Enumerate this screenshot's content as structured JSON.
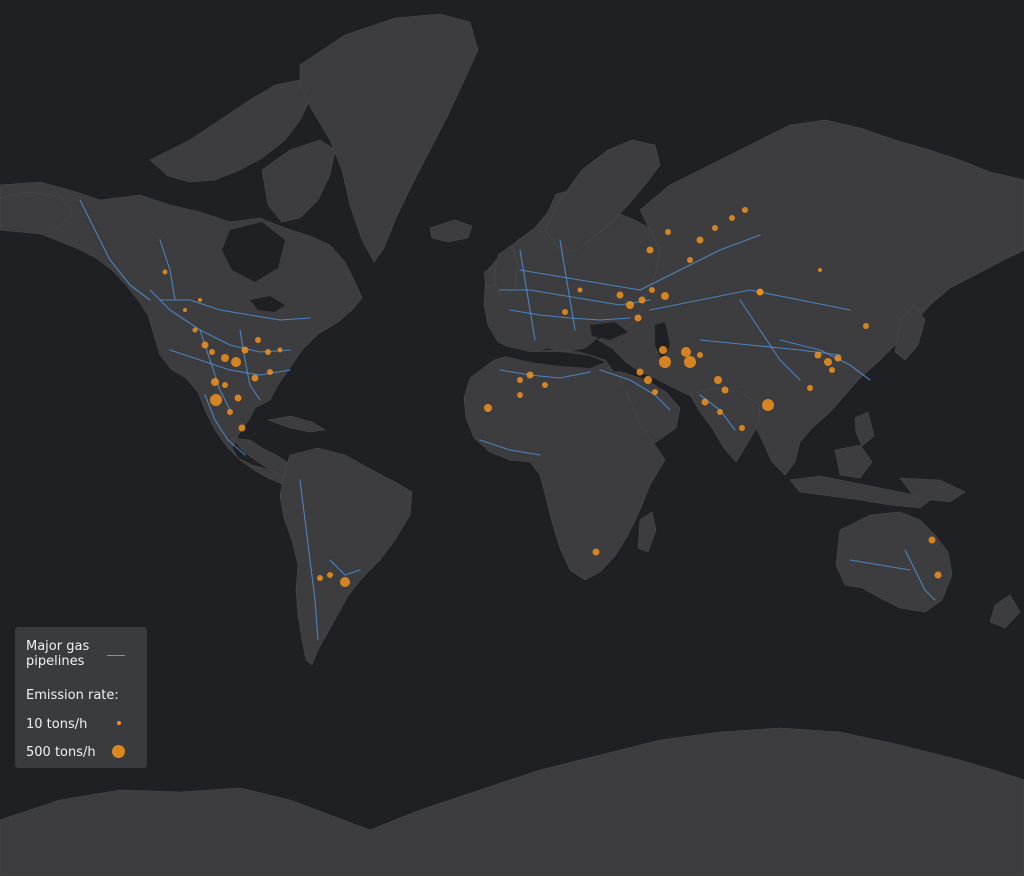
{
  "map": {
    "basemap": "dark world map, Mercator-like projection",
    "colors": {
      "ocean": "#1f2024",
      "land": "#3d3d3f",
      "pipelines": "#4d8fd6",
      "emissions": "#f0901e",
      "legend_bg": "#3a3b3f"
    },
    "layers": [
      "land",
      "major-gas-pipelines",
      "emission-points"
    ]
  },
  "legend": {
    "pipeline_label": "Major gas pipelines",
    "emission_title": "Emission rate:",
    "small": {
      "label": "10 tons/h",
      "value": 10
    },
    "large": {
      "label": "500 tons/h",
      "value": 500
    }
  }
}
